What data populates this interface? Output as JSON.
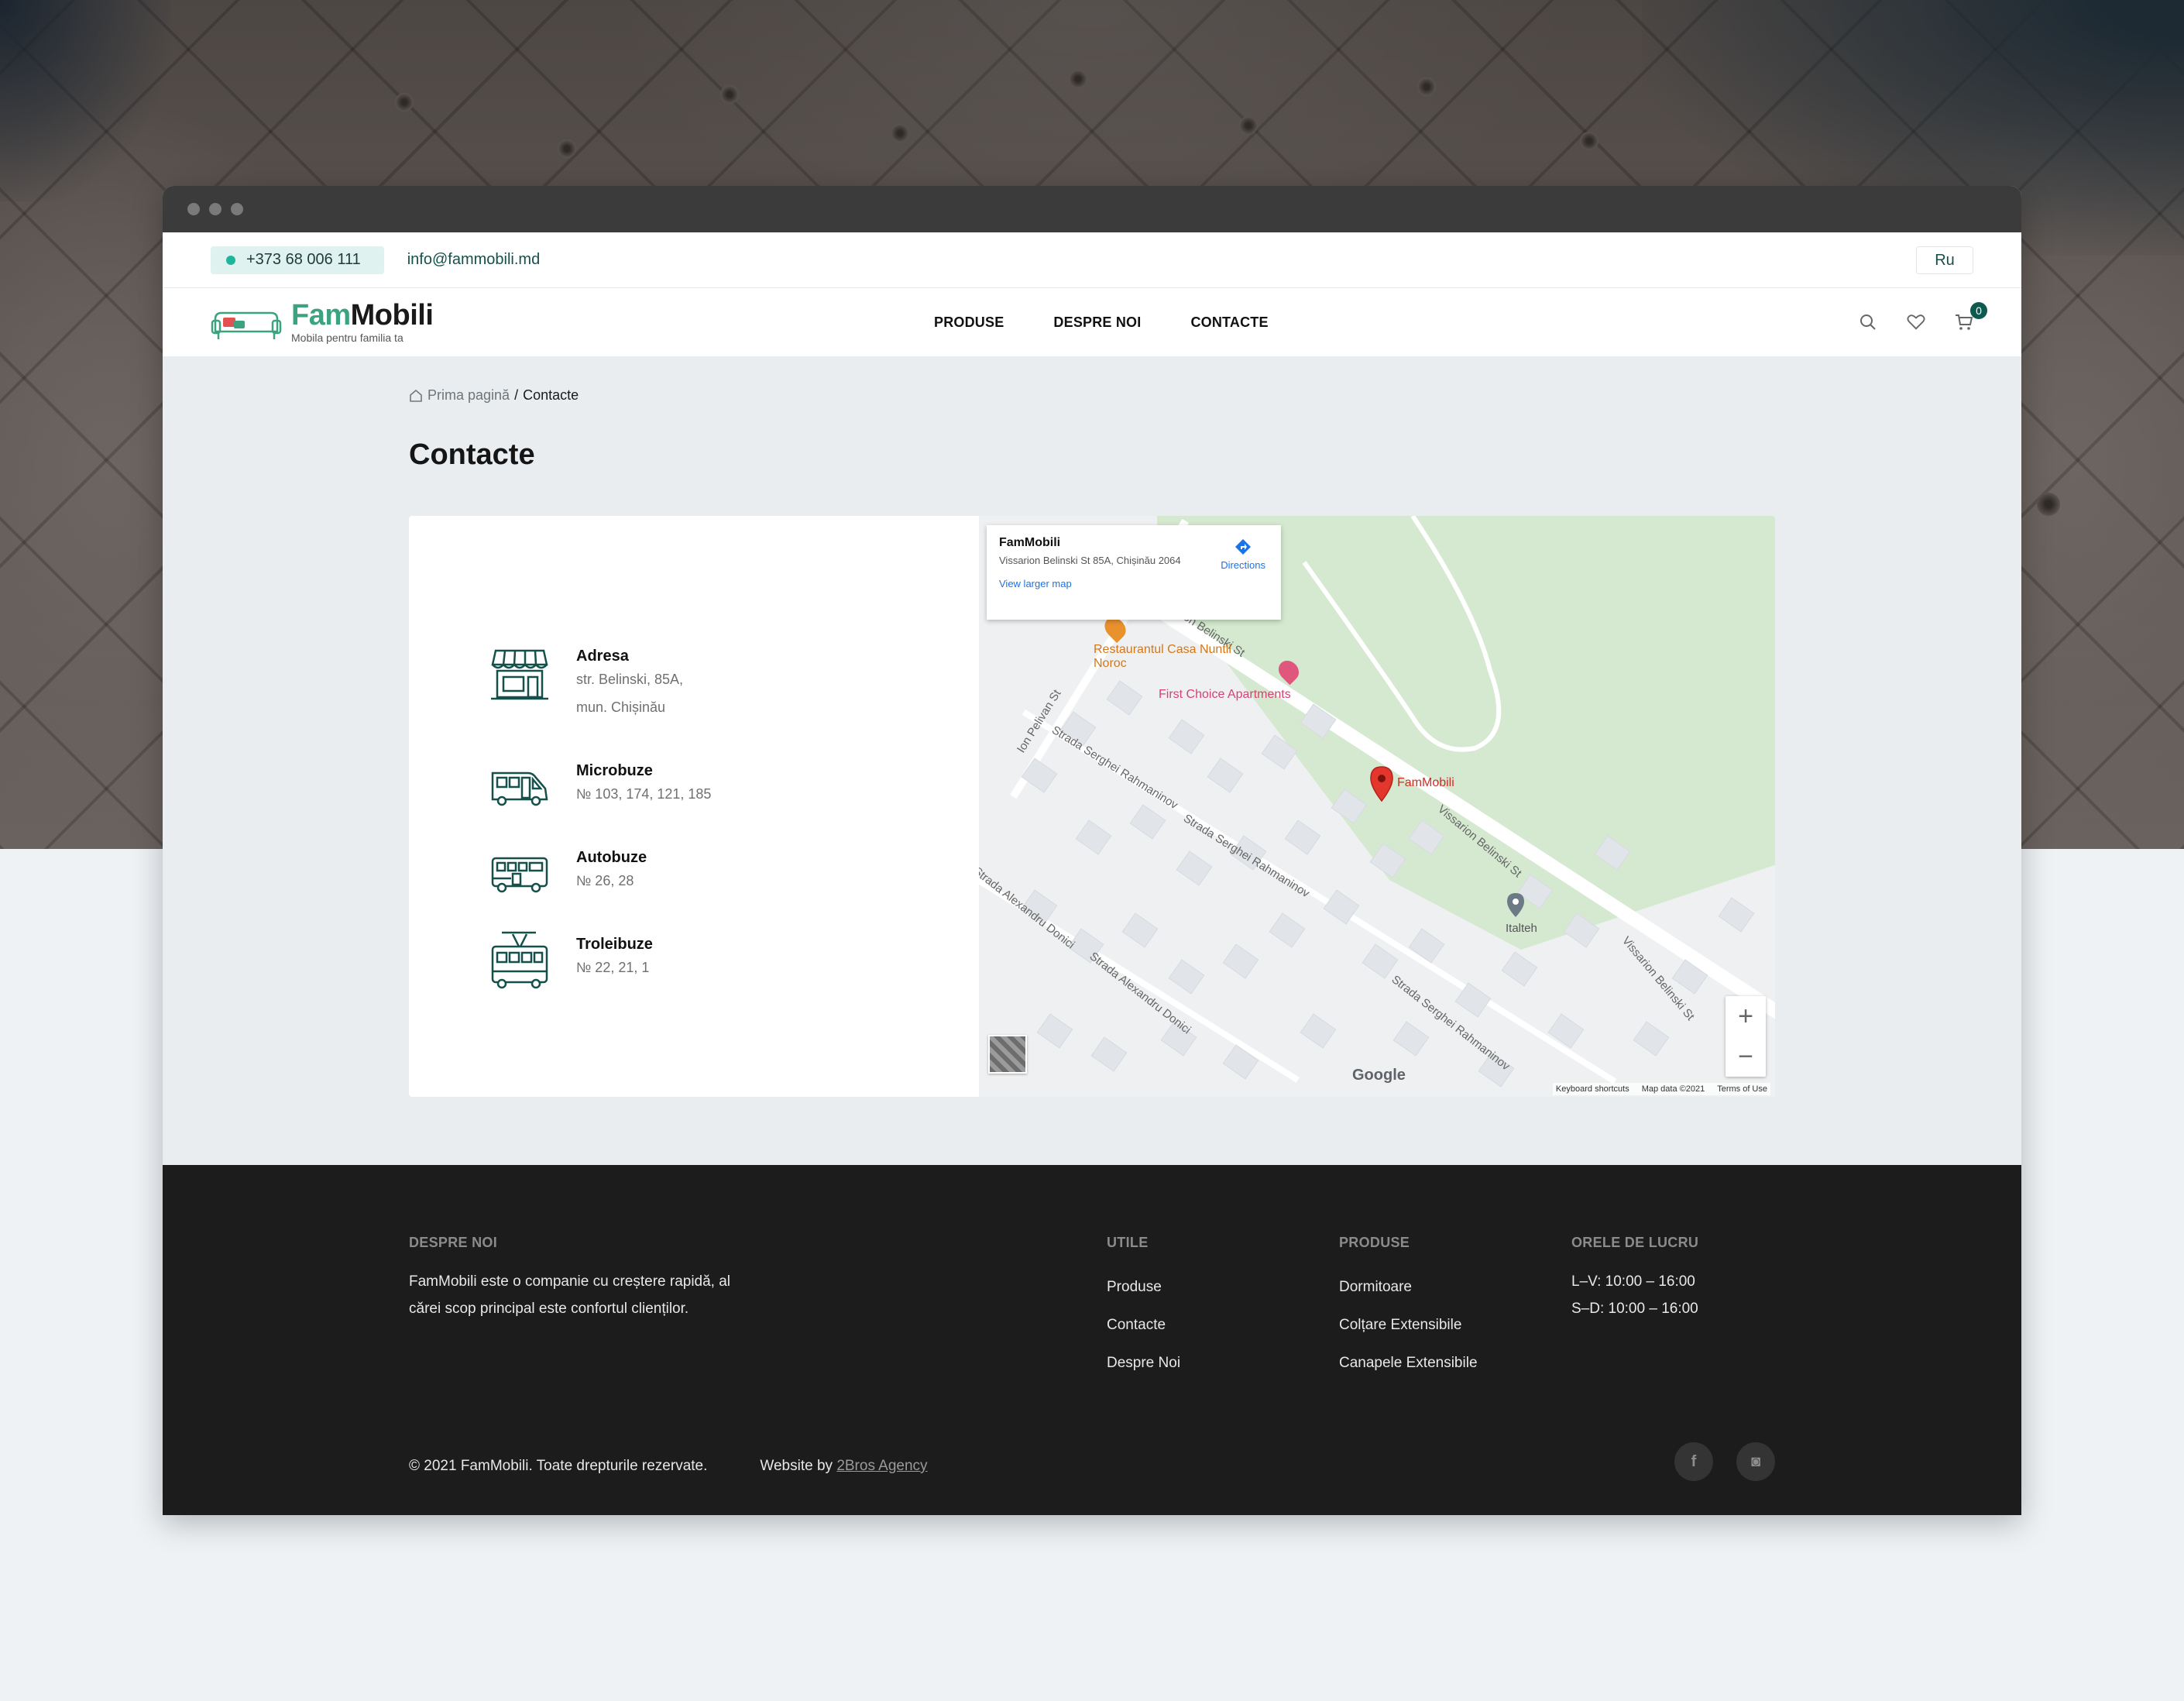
{
  "topbar": {
    "phone": "+373 68 006 111",
    "email": "info@fammobili.md",
    "language": "Ru"
  },
  "logo": {
    "name_part1": "Fam",
    "name_part2": "Mobili",
    "tagline": "Mobila pentru familia ta"
  },
  "nav": {
    "items": [
      "PRODUSE",
      "DESPRE NOI",
      "CONTACTE"
    ],
    "cart_count": "0"
  },
  "breadcrumb": {
    "home": "Prima pagină",
    "separator": "/",
    "current": "Contacte"
  },
  "page_title": "Contacte",
  "contacts": [
    {
      "title": "Adresa",
      "lines": [
        "str. Belinski, 85A,",
        "mun. Chișinău"
      ],
      "icon": "storefront-icon"
    },
    {
      "title": "Microbuze",
      "lines": [
        "№ 103, 174, 121, 185"
      ],
      "icon": "minibus-icon"
    },
    {
      "title": "Autobuze",
      "lines": [
        "№ 26, 28"
      ],
      "icon": "bus-icon"
    },
    {
      "title": "Troleibuze",
      "lines": [
        "№ 22, 21, 1"
      ],
      "icon": "trolleybus-icon"
    }
  ],
  "map": {
    "place_name": "FamMobili",
    "place_address": "Vissarion Belinski St 85A, Chișinău 2064",
    "directions": "Directions",
    "larger_map": "View larger map",
    "pin_label": "FamMobili",
    "poi_restaurant": "Restaurantul Casa Nuntii Noroc",
    "poi_apartments": "First Choice Apartments",
    "poi_italteh": "Italteh",
    "street_belinski": "Vissarion Belinski St",
    "street_belinski_top": "on Belinski St",
    "street_pelivan": "Ion Pelivan St",
    "street_rahmaninov": "Strada Serghei Rahmaninov",
    "street_donici": "Strada Alexandru Donici",
    "google": "Google",
    "keyboard": "Keyboard shortcuts",
    "map_data": "Map data ©2021",
    "terms": "Terms of Use",
    "zoom_in": "+",
    "zoom_out": "−"
  },
  "footer": {
    "about_head": "DESPRE NOI",
    "about_text": "FamMobili este o companie cu creștere rapidă, al cărei scop principal este confortul clienților.",
    "useful_head": "UTILE",
    "useful_links": [
      "Produse",
      "Contacte",
      "Despre Noi"
    ],
    "products_head": "PRODUSE",
    "products_links": [
      "Dormitoare",
      "Colțare Extensibile",
      "Canapele Extensibile"
    ],
    "hours_head": "ORELE DE LUCRU",
    "hours": [
      "L–V: 10:00 – 16:00",
      "S–D: 10:00 – 16:00"
    ],
    "copyright": "© 2021 FamMobili. Toate drepturile rezervate.",
    "website_by": "Website by",
    "agency": "2Bros Agency"
  },
  "socials": [
    {
      "icon": "facebook-icon",
      "glyph": "f"
    },
    {
      "icon": "instagram-icon",
      "glyph": "◙"
    }
  ],
  "colors": {
    "brand_green": "#3ba37f",
    "brand_dark": "#0f5a4f",
    "footer_bg": "#1c1c1d"
  }
}
